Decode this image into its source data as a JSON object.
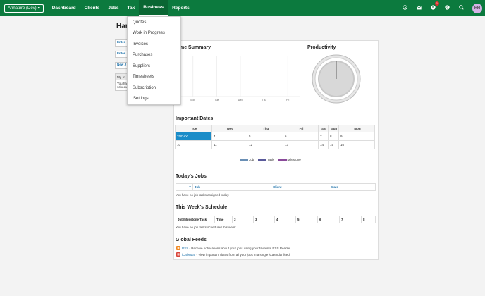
{
  "topbar": {
    "org_label": "Annature (Dev)",
    "org_caret": "▾",
    "nav": [
      "Dashboard",
      "Clients",
      "Jobs",
      "Tax",
      "Business",
      "Reports"
    ],
    "notification_count": "1",
    "avatar": "HH"
  },
  "page": {
    "title": "Harr"
  },
  "left_panel": {
    "buttons": [
      "Enter",
      "Enter",
      "New J"
    ],
    "box_header": "My Jo",
    "box_body": "You ha schedu"
  },
  "dropdown": {
    "items": [
      "Quotes",
      "Work in Progress",
      "Invoices",
      "Purchases",
      "Suppliers",
      "Timesheets",
      "Subscription",
      "Settings"
    ]
  },
  "time_summary": {
    "title": "me Summary",
    "chart_data": {
      "type": "bar",
      "categories": [
        "Mon",
        "Tue",
        "Wed",
        "Thu",
        "Fri"
      ],
      "values": [
        0,
        0,
        0,
        0,
        0
      ]
    }
  },
  "productivity": {
    "title": "Productivity"
  },
  "important_dates": {
    "title": "Important Dates",
    "headers": [
      "Tue",
      "Wed",
      "Thu",
      "Fri",
      "Sat",
      "Sun",
      "Mon"
    ],
    "rows": [
      [
        "TODAY",
        "4",
        "5",
        "6",
        "7",
        "8",
        "9"
      ],
      [
        "10",
        "11",
        "12",
        "13",
        "14",
        "15",
        "16"
      ]
    ],
    "legend": [
      {
        "label": "Job",
        "color": "#6a8fb5"
      },
      {
        "label": "Task",
        "color": "#5a5a9a"
      },
      {
        "label": "Milestone",
        "color": "#8a4a9a"
      }
    ]
  },
  "todays_jobs": {
    "title": "Today's Jobs",
    "headers": [
      "T",
      "Job",
      "Client",
      "State"
    ],
    "empty": "You have no job tasks assigned today."
  },
  "weekly_schedule": {
    "title": "This Week's Schedule",
    "headers": [
      "Job/Milestone/Task",
      "Time",
      "3",
      "3",
      "4",
      "5",
      "6",
      "7",
      "8"
    ],
    "empty": "You have no job tasks scheduled this week."
  },
  "global_feeds": {
    "title": "Global Feeds",
    "rss_link": "RSS",
    "rss_text": " - Receive notifications about your jobs using your favourite RSS Reader.",
    "ical_link": "iCalendar",
    "ical_text": " - View important dates from all your jobs in a single iCalendar feed."
  }
}
